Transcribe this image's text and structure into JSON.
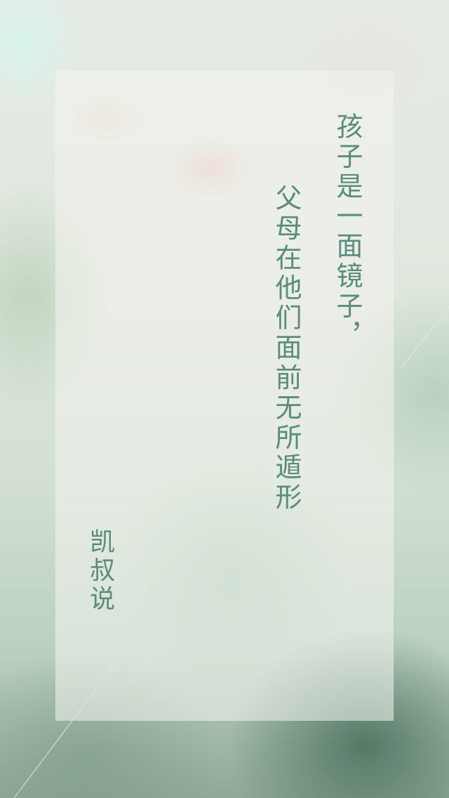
{
  "quote": {
    "line1": "孩子是一面镜子，",
    "line2": "父母在他们面前无所遁形"
  },
  "author": "凯叔说",
  "colors": {
    "text": "#5a8c7c",
    "panel": "rgba(244,244,238,0.55)",
    "line": "#cfe0db"
  }
}
